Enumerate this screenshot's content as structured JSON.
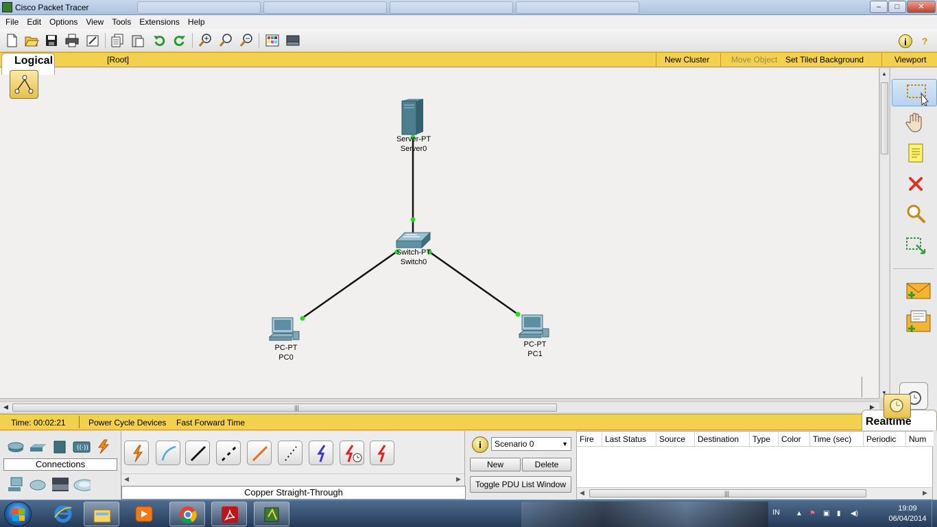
{
  "window": {
    "title": "Cisco Packet Tracer",
    "controls": {
      "minimize": "–",
      "maximize": "□",
      "close": "✕"
    }
  },
  "menu": [
    "File",
    "Edit",
    "Options",
    "View",
    "Tools",
    "Extensions",
    "Help"
  ],
  "toolbar": {
    "buttons": [
      "new-icon",
      "open-icon",
      "save-icon",
      "print-icon",
      "activity-wizard-icon",
      "copy-icon",
      "paste-icon",
      "undo-icon",
      "redo-icon",
      "zoom-in-icon",
      "zoom-reset-icon",
      "zoom-out-icon",
      "palette-icon",
      "custom-device-icon"
    ],
    "info": "i",
    "help": "?"
  },
  "logical_bar": {
    "tab": "Logical",
    "root": "[Root]",
    "new_cluster": "New Cluster",
    "move_object": "Move Object",
    "set_tiled_background": "Set Tiled Background",
    "viewport": "Viewport"
  },
  "devices": {
    "server": {
      "type": "Server-PT",
      "name": "Server0"
    },
    "switch": {
      "type": "Switch-PT",
      "name": "Switch0"
    },
    "pc0": {
      "type": "PC-PT",
      "name": "PC0"
    },
    "pc1": {
      "type": "PC-PT",
      "name": "PC1"
    }
  },
  "link_color": "#111111",
  "link_status_color": "#22dd22",
  "right_tools": [
    "select-icon",
    "hand-icon",
    "note-icon",
    "delete-icon",
    "inspect-icon",
    "resize-shape-icon",
    "add-simple-pdu-icon",
    "add-complex-pdu-icon"
  ],
  "time_bar": {
    "time": "Time: 00:02:21",
    "power_cycle": "Power Cycle Devices",
    "fast_forward": "Fast Forward Time",
    "mode": "Realtime"
  },
  "device_panel": {
    "category_label": "Connections",
    "categories_top": [
      "router-category-icon",
      "switch-category-icon",
      "hub-category-icon",
      "wireless-category-icon",
      "connections-category-icon"
    ],
    "categories_bottom": [
      "end-devices-category-icon",
      "wan-emulation-category-icon",
      "custom-devices-category-icon",
      "multiuser-category-icon"
    ],
    "cables": [
      "automatic-cable-icon",
      "console-cable-icon",
      "copper-straight-icon",
      "copper-cross-icon",
      "fiber-cable-icon",
      "phone-cable-icon",
      "coaxial-cable-icon",
      "serial-dce-icon",
      "serial-dte-icon"
    ],
    "selected_cable": "Copper Straight-Through"
  },
  "scenario": {
    "info": "i",
    "selected": "Scenario 0",
    "new": "New",
    "delete": "Delete",
    "toggle": "Toggle PDU List Window"
  },
  "pdu_list": {
    "columns": [
      "Fire",
      "Last Status",
      "Source",
      "Destination",
      "Type",
      "Color",
      "Time (sec)",
      "Periodic",
      "Num"
    ]
  },
  "taskbar": {
    "apps": [
      "ie-icon",
      "explorer-icon",
      "media-player-icon",
      "chrome-icon",
      "acrobat-icon",
      "packet-tracer-icon"
    ],
    "tray_language": "IN",
    "time": "19:09",
    "date": "06/04/2014"
  }
}
